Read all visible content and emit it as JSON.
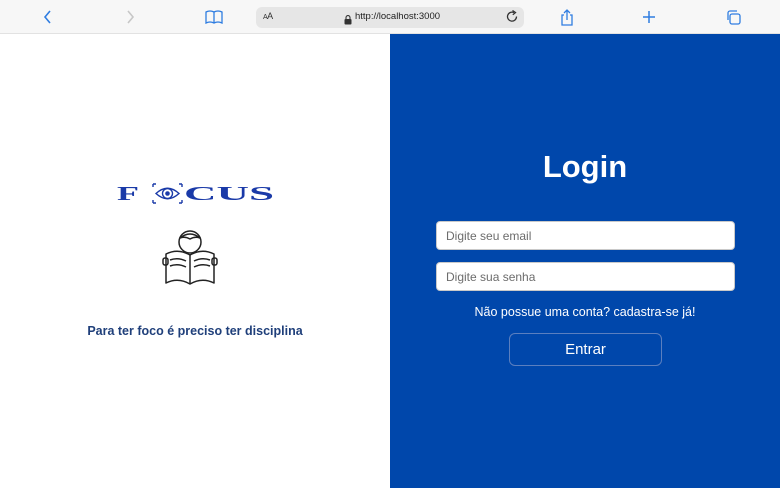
{
  "browser": {
    "address_aa": "AA",
    "url": "http://localhost:3000"
  },
  "brand": {
    "logo_text": "FOCUS",
    "tagline": "Para ter foco é preciso ter disciplina",
    "logo_color": "#1a3aa8"
  },
  "login": {
    "title": "Login",
    "email_placeholder": "Digite seu email",
    "password_placeholder": "Digite sua senha",
    "signup_text": "Não possue uma conta? cadastra-se já!",
    "submit_label": "Entrar",
    "panel_color": "#0047ab"
  }
}
